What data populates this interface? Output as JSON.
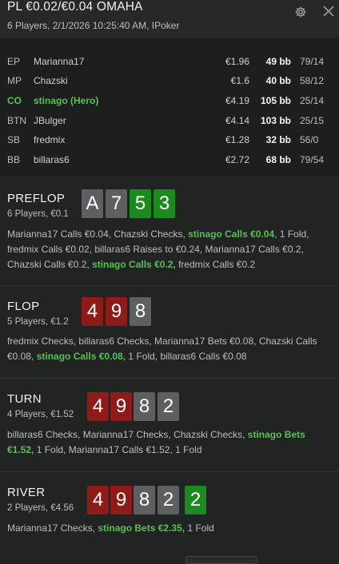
{
  "header": {
    "title": "PL €0.02/€0.04 OMAHA",
    "subtitle": "6 Players, 2/1/2026 10:25:40 AM, IPoker"
  },
  "players": [
    {
      "pos": "EP",
      "name": "Marianna17",
      "stack": "€1.96",
      "bb": "49 bb",
      "stat": "79/14",
      "hero": false
    },
    {
      "pos": "MP",
      "name": "Chazski",
      "stack": "€1.6",
      "bb": "40 bb",
      "stat": "58/12",
      "hero": false
    },
    {
      "pos": "CO",
      "name": "stinago (Hero)",
      "stack": "€4.19",
      "bb": "105 bb",
      "stat": "25/14",
      "hero": true
    },
    {
      "pos": "BTN",
      "name": "JBulger",
      "stack": "€4.14",
      "bb": "103 bb",
      "stat": "25/15",
      "hero": false
    },
    {
      "pos": "SB",
      "name": "fredmix",
      "stack": "€1.28",
      "bb": "32 bb",
      "stat": "56/0",
      "hero": false
    },
    {
      "pos": "BB",
      "name": "billaras6",
      "stack": "€2.72",
      "bb": "68 bb",
      "stat": "79/54",
      "hero": false
    }
  ],
  "streets": [
    {
      "name": "PREFLOP",
      "info": "6 Players, €0.1",
      "cards": [
        {
          "rank": "A",
          "suit": "s"
        },
        {
          "rank": "7",
          "suit": "s"
        },
        {
          "rank": "5",
          "suit": "c"
        },
        {
          "rank": "3",
          "suit": "c"
        }
      ],
      "actions": [
        {
          "text": "Marianna17 Calls €0.04, Chazski Checks, ",
          "hero": false
        },
        {
          "text": "stinago Calls €0.04",
          "hero": true
        },
        {
          "text": ", 1 Fold, fredmix Calls €0.02, billaras6 Raises to €0.24, Marianna17 Calls €0.2, Chazski Calls €0.2, ",
          "hero": false
        },
        {
          "text": "stinago Calls €0.2,",
          "hero": true
        },
        {
          "text": " fredmix Calls €0.2",
          "hero": false
        }
      ]
    },
    {
      "name": "FLOP",
      "info": "5 Players, €1.2",
      "cards": [
        {
          "rank": "4",
          "suit": "h"
        },
        {
          "rank": "9",
          "suit": "h"
        },
        {
          "rank": "8",
          "suit": "s"
        }
      ],
      "actions": [
        {
          "text": "fredmix Checks, billaras6 Checks, Marianna17 Bets €0.08, Chazski Calls €0.08, ",
          "hero": false
        },
        {
          "text": "stinago Calls €0.08,",
          "hero": true
        },
        {
          "text": " 1 Fold, billaras6 Calls €0.08",
          "hero": false
        }
      ]
    },
    {
      "name": "TURN",
      "info": "4 Players, €1.52",
      "cards": [
        {
          "rank": "4",
          "suit": "h"
        },
        {
          "rank": "9",
          "suit": "h"
        },
        {
          "rank": "8",
          "suit": "s"
        },
        {
          "rank": "2",
          "suit": "s"
        }
      ],
      "actions": [
        {
          "text": "billaras6 Checks, Marianna17 Checks, Chazski Checks, ",
          "hero": false
        },
        {
          "text": "stinago Bets €1.52,",
          "hero": true
        },
        {
          "text": " 1 Fold, Marianna17 Calls €1.52, 1 Fold",
          "hero": false
        }
      ]
    },
    {
      "name": "RIVER",
      "info": "2 Players, €4.56",
      "cards": [
        {
          "rank": "4",
          "suit": "h"
        },
        {
          "rank": "9",
          "suit": "h"
        },
        {
          "rank": "8",
          "suit": "s"
        },
        {
          "rank": "2",
          "suit": "s"
        },
        {
          "rank": "2",
          "suit": "c"
        }
      ],
      "actions": [
        {
          "text": "Marianna17 Checks, ",
          "hero": false
        },
        {
          "text": "stinago Bets €2.35,",
          "hero": true
        },
        {
          "text": " 1 Fold",
          "hero": false
        }
      ]
    }
  ],
  "colors": {
    "hero": "#57c053",
    "card_spade": "#5d5f61",
    "card_heart": "#8e1b17",
    "card_club": "#1d8a1f"
  },
  "icons": {
    "settings": "gear-icon",
    "close": "close-icon"
  }
}
